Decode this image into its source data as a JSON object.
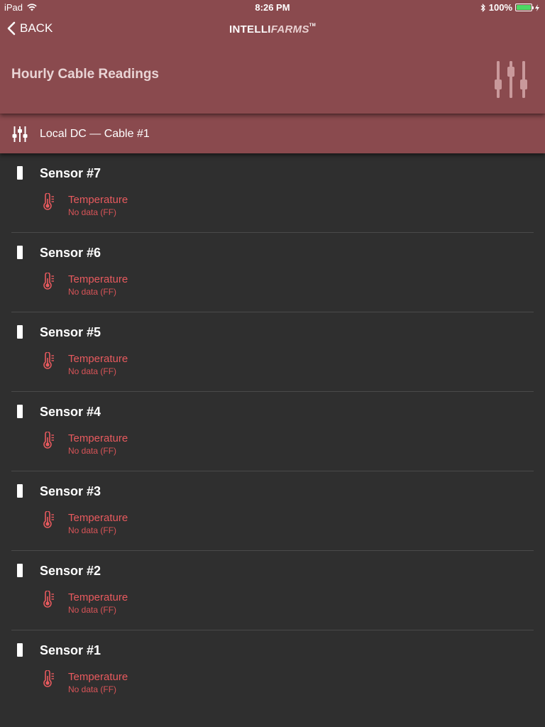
{
  "status_bar": {
    "device": "iPad",
    "time": "8:26 PM",
    "battery": "100%",
    "battery_level": 1.0
  },
  "nav": {
    "back_label": "BACK",
    "logo_main": "INTELLI",
    "logo_italic": "FARMS",
    "logo_tm": "TM"
  },
  "page": {
    "title": "Hourly Cable Readings"
  },
  "subheader": {
    "label": "Local DC — Cable #1"
  },
  "colors": {
    "header": "#8a4a4e",
    "background": "#2f2f2f",
    "reading_red": "#e85a5e"
  },
  "sensors": [
    {
      "name": "Sensor #7",
      "reading_label": "Temperature",
      "reading_value": "No data (FF)",
      "icon": "thermometer-icon"
    },
    {
      "name": "Sensor #6",
      "reading_label": "Temperature",
      "reading_value": "No data (FF)",
      "icon": "thermometer-icon"
    },
    {
      "name": "Sensor #5",
      "reading_label": "Temperature",
      "reading_value": "No data (FF)",
      "icon": "thermometer-icon"
    },
    {
      "name": "Sensor #4",
      "reading_label": "Temperature",
      "reading_value": "No data (FF)",
      "icon": "thermometer-icon"
    },
    {
      "name": "Sensor #3",
      "reading_label": "Temperature",
      "reading_value": "No data (FF)",
      "icon": "thermometer-icon"
    },
    {
      "name": "Sensor #2",
      "reading_label": "Temperature",
      "reading_value": "No data (FF)",
      "icon": "thermometer-icon"
    },
    {
      "name": "Sensor #1",
      "reading_label": "Temperature",
      "reading_value": "No data (FF)",
      "icon": "thermometer-icon"
    }
  ]
}
